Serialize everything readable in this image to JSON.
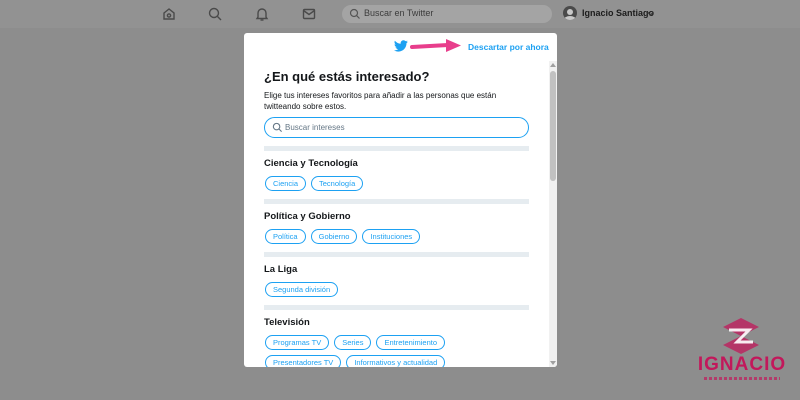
{
  "topbar": {
    "icons": [
      "home-icon",
      "explore-icon",
      "notifications-icon",
      "messages-icon"
    ],
    "search_placeholder": "Buscar en Twitter",
    "user_name": "Ignacio Santiago"
  },
  "modal": {
    "dismiss_label": "Descartar por ahora",
    "title": "¿En qué estás interesado?",
    "subtitle": "Elige tus intereses favoritos para añadir a las personas que están twitteando sobre estos.",
    "search_placeholder": "Buscar intereses",
    "sections": [
      {
        "title": "Ciencia y Tecnología",
        "chips": [
          "Ciencia",
          "Tecnología"
        ]
      },
      {
        "title": "Política y Gobierno",
        "chips": [
          "Política",
          "Gobierno",
          "Instituciones"
        ]
      },
      {
        "title": "La Liga",
        "chips": [
          "Segunda división"
        ]
      },
      {
        "title": "Televisión",
        "chips": [
          "Programas TV",
          "Series",
          "Entretenimiento",
          "Presentadores TV",
          "Informativos y actualidad"
        ]
      }
    ]
  },
  "brand": {
    "name": "IGNACIO",
    "color": "#c2185b"
  },
  "colors": {
    "accent": "#1da1f2",
    "overlay": "#8d8d8d",
    "highlight_arrow": "#e83e8c"
  }
}
